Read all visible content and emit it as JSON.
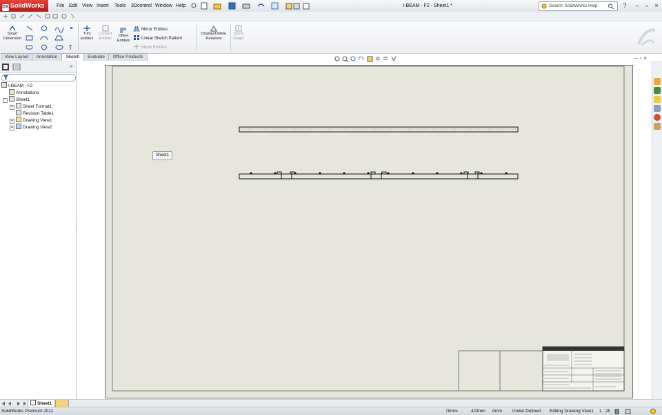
{
  "app": {
    "brand": "SolidWorks",
    "document_title": "I-BEAM - F2 - Sheet1 *",
    "search_placeholder": "Search SolidWorks Help",
    "help_symbol": "?",
    "accent_color": "#b11d18"
  },
  "menu": [
    "File",
    "Edit",
    "View",
    "Insert",
    "Tools",
    "3Dcontrol",
    "Window",
    "Help"
  ],
  "ribbon": {
    "smart_dimension": [
      "Smart",
      "Dimension"
    ],
    "trim_entities": [
      "Trim",
      "Entities"
    ],
    "convert_entities": [
      "Convert",
      "Entities"
    ],
    "offset_entities": [
      "Offset",
      "Entities"
    ],
    "mirror_entities": "Mirror Entities",
    "linear_sketch_pattern": "Linear Sketch Pattern",
    "move_entities": "Move Entities",
    "display_delete_relations": [
      "Display/Delete",
      "Relations"
    ],
    "quick_snaps": [
      "Quick",
      "Snaps"
    ]
  },
  "tabs": [
    {
      "label": "View Layout",
      "active": false
    },
    {
      "label": "Annotation",
      "active": false
    },
    {
      "label": "Sketch",
      "active": true
    },
    {
      "label": "Evaluate",
      "active": false
    },
    {
      "label": "Office Products",
      "active": false
    }
  ],
  "feature_tree": {
    "root": "I-BEAM - F2",
    "items": [
      {
        "label": "Annotations",
        "level": 1,
        "icon": "annotations-icon"
      },
      {
        "label": "Sheet1",
        "level": 1,
        "icon": "sheet-icon"
      },
      {
        "label": "Sheet Format1",
        "level": 2,
        "icon": "sheet-format-icon"
      },
      {
        "label": "Revision Table1",
        "level": 2,
        "icon": "revision-table-icon"
      },
      {
        "label": "Drawing View1",
        "level": 2,
        "icon": "drawing-view-icon"
      },
      {
        "label": "Drawing View2",
        "level": 2,
        "icon": "drawing-view-icon"
      }
    ]
  },
  "drawing": {
    "sheet_label": "Sheet1"
  },
  "sheet_tabs": {
    "active": "Sheet1"
  },
  "status_bar": {
    "product": "SolidWorks Premium 2011",
    "x": "78mm",
    "y": "423mm",
    "z": "0mm",
    "definition": "Under Defined",
    "mode": "Editing Drawing View1",
    "scale": "1 : 25"
  }
}
